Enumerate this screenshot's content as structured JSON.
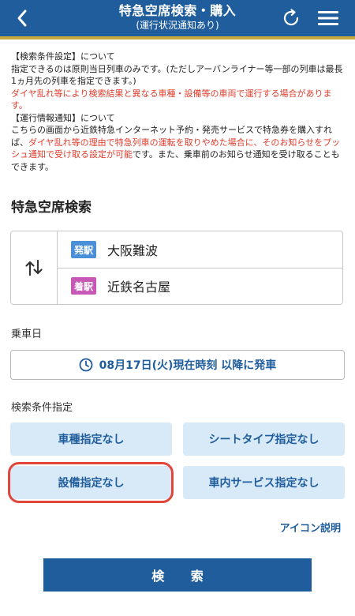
{
  "header": {
    "title": "特急空席検索・購入",
    "subtitle": "(運行状況通知あり)"
  },
  "notice": {
    "l1": "【検索条件設定】について",
    "l2": "指定できるのは原則当日列車のみです。(ただしアーバンライナー等一部の列車は最長1ヵ月先の列車を指定できます。)",
    "l3_red": "ダイヤ乱れ等により検索結果と異なる車種・設備等の車両で運行する場合があります。",
    "l4": "【運行情報通知】について",
    "l5a": "こちらの画面から近鉄特急インターネット予約・発売サービスで特急券を購入すれば、",
    "l5b_red": "ダイヤ乱れ等の理由で特急列車の運転を取りやめた場合に、そのお知らせをプッシュ通知で受け取る設定が可能",
    "l5c": "です。また、乗車前のお知らせ通知を受け取ることもできます。"
  },
  "search_section": {
    "title": "特急空席検索",
    "from_badge": "発駅",
    "from_station": "大阪難波",
    "to_badge": "着駅",
    "to_station": "近鉄名古屋"
  },
  "boarding": {
    "label": "乗車日",
    "date_button": "08月17日(火)現在時刻 以降に発車"
  },
  "conditions": {
    "label": "検索条件指定",
    "car_type": "車種指定なし",
    "seat_type": "シートタイプ指定なし",
    "equipment": "設備指定なし",
    "service": "車内サービス指定なし",
    "icon_help": "アイコン説明"
  },
  "search_button": "検 索",
  "colors": {
    "header_bg": "#1f5d9c",
    "header_accent": "#c9a93c",
    "notice_red": "#e03c2c",
    "chip_bg": "#d8e9f8",
    "highlight": "#e0473a"
  }
}
